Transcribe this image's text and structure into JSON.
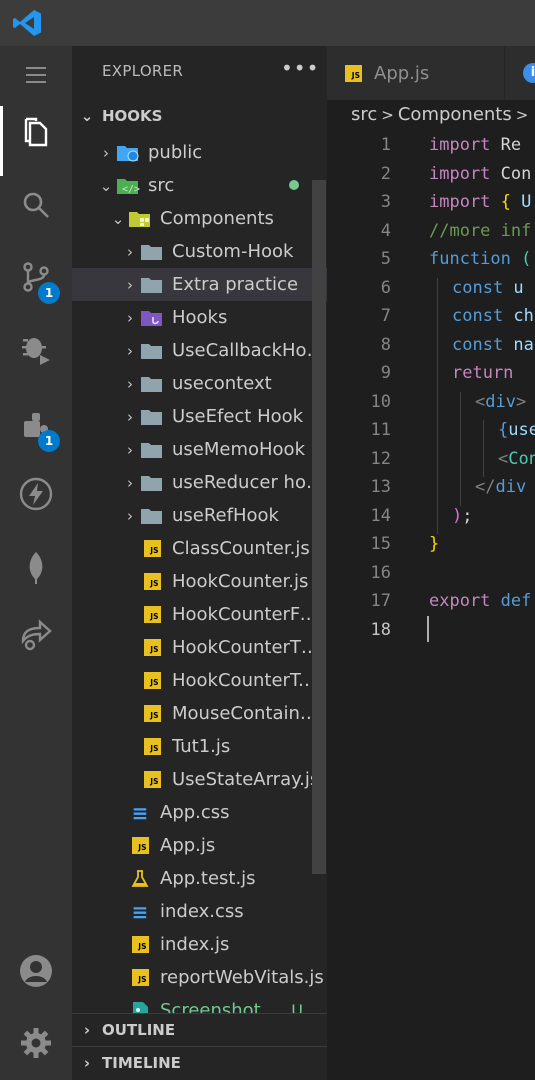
{
  "colors": {
    "accent": "#007acc",
    "js_icon": "#e8c120",
    "css_icon": "#42a5f5",
    "git_modified": "#73c991"
  },
  "activity": {
    "scm_badge": "1",
    "extensions_badge": "1"
  },
  "sidebar": {
    "title": "EXPLORER",
    "more_label": "•••",
    "workspace": "HOOKS",
    "outline": "OUTLINE",
    "timeline": "TIMELINE",
    "tree": [
      {
        "label": "public",
        "icon": "globe-folder-icon"
      },
      {
        "label": "src",
        "icon": "src-folder-icon"
      },
      {
        "label": "Components",
        "icon": "components-folder-icon"
      },
      {
        "label": "Custom-Hook",
        "icon": "folder-icon"
      },
      {
        "label": "Extra practice",
        "icon": "folder-icon"
      },
      {
        "label": "Hooks",
        "icon": "hooks-folder-icon"
      },
      {
        "label": "UseCallbackHook",
        "icon": "folder-icon"
      },
      {
        "label": "usecontext",
        "icon": "folder-icon"
      },
      {
        "label": "UseEfect Hook",
        "icon": "folder-icon"
      },
      {
        "label": "useMemoHook",
        "icon": "folder-icon"
      },
      {
        "label": "useReducer hook",
        "icon": "folder-icon"
      },
      {
        "label": "useRefHook",
        "icon": "folder-icon"
      },
      {
        "label": "ClassCounter.js",
        "icon": "js-icon"
      },
      {
        "label": "HookCounter.js",
        "icon": "js-icon"
      },
      {
        "label": "HookCounterFour.js",
        "icon": "js-icon"
      },
      {
        "label": "HookCounterThree.js",
        "icon": "js-icon"
      },
      {
        "label": "HookCounterTwo.js",
        "icon": "js-icon"
      },
      {
        "label": "MouseContainer.js",
        "icon": "js-icon"
      },
      {
        "label": "Tut1.js",
        "icon": "js-icon"
      },
      {
        "label": "UseStateArray.js",
        "icon": "js-icon"
      },
      {
        "label": "App.css",
        "icon": "css-icon"
      },
      {
        "label": "App.js",
        "icon": "js-icon"
      },
      {
        "label": "App.test.js",
        "icon": "test-icon"
      },
      {
        "label": "index.css",
        "icon": "css-icon"
      },
      {
        "label": "index.js",
        "icon": "js-icon"
      },
      {
        "label": "reportWebVitals.js",
        "icon": "js-icon"
      },
      {
        "label": "Screenshot ...",
        "icon": "image-icon",
        "status": "U"
      }
    ]
  },
  "editor": {
    "tab_label": "App.js",
    "js_badge": "JS",
    "breadcrumb": [
      "src",
      "Components"
    ],
    "line_numbers": [
      "1",
      "2",
      "3",
      "4",
      "5",
      "6",
      "7",
      "8",
      "9",
      "10",
      "11",
      "12",
      "13",
      "14",
      "15",
      "16",
      "17",
      "18"
    ],
    "current_line": "18",
    "code": {
      "l1_kw": "import",
      "l1_rest": " Re",
      "l2_kw": "import",
      "l2_rest": " Con",
      "l3_kw": "import",
      "l3_br": " {",
      "l3_rest": " U",
      "l4": "//more inf",
      "l5_kw": "function",
      "l5_rest": " (",
      "l6_kw": "const",
      "l6_rest": " u",
      "l7_kw": "const",
      "l7_rest": " ch",
      "l8_kw": "const",
      "l8_rest": " na",
      "l9_kw": "return",
      "l10_open": "<",
      "l10_tag": "div",
      "l10_close": ">",
      "l11_br": "{",
      "l11_rest": "use",
      "l12_open": "<",
      "l12_rest": "Con",
      "l13_open": "</",
      "l13_tag": "div",
      "l14_br": ")",
      "l14_rest": ";",
      "l15_br": "}",
      "l17_kw": "export",
      "l17_rest": " def"
    }
  }
}
